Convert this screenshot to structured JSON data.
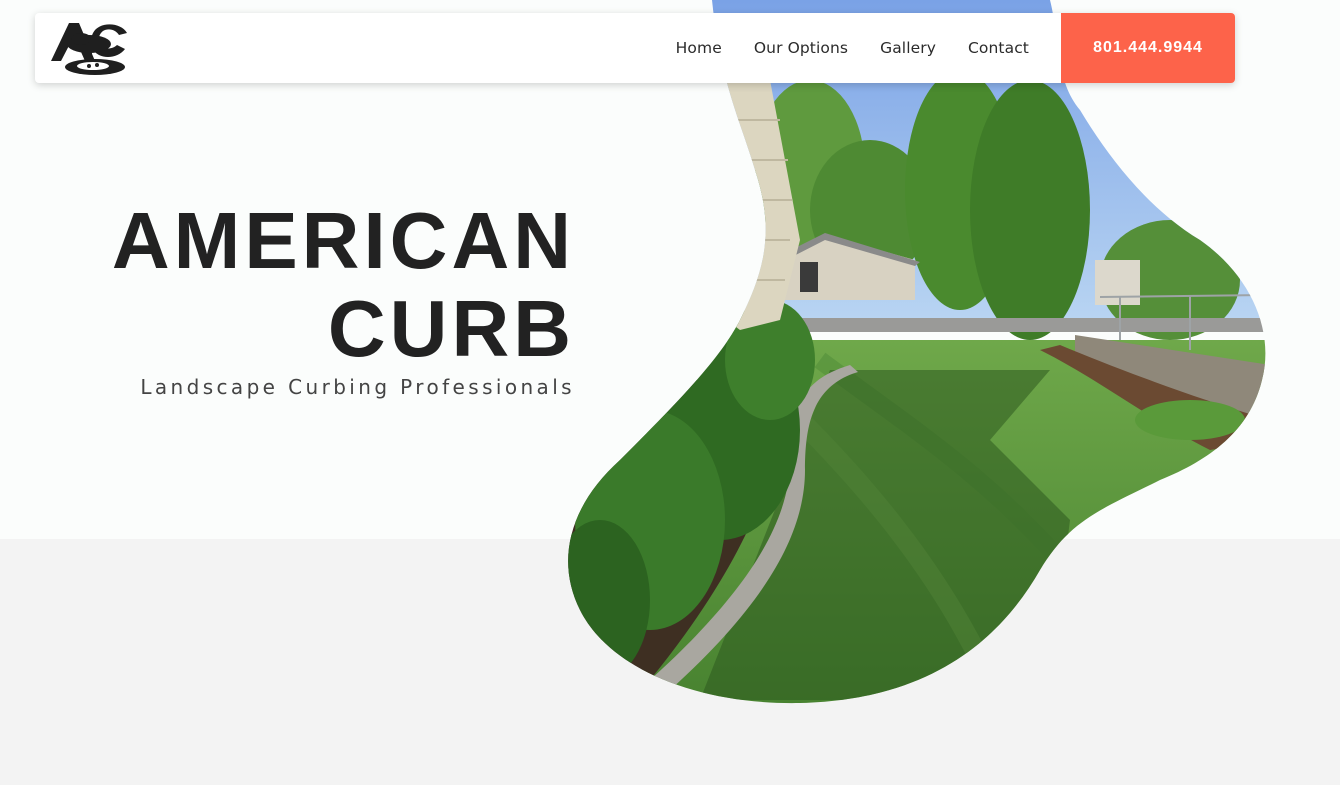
{
  "nav": {
    "logo_alt": "AC",
    "items": [
      {
        "label": "Home"
      },
      {
        "label": "Our Options"
      },
      {
        "label": "Gallery"
      },
      {
        "label": "Contact"
      }
    ],
    "phone": "801.444.9944"
  },
  "hero": {
    "title_line1": "AMERICAN",
    "title_line2": "CURB",
    "subtitle": "Landscape Curbing Professionals"
  },
  "colors": {
    "accent": "#fd634a",
    "text_dark": "#222222",
    "hero_bg": "#fbfdfc",
    "section_bg": "#f3f3f3"
  }
}
